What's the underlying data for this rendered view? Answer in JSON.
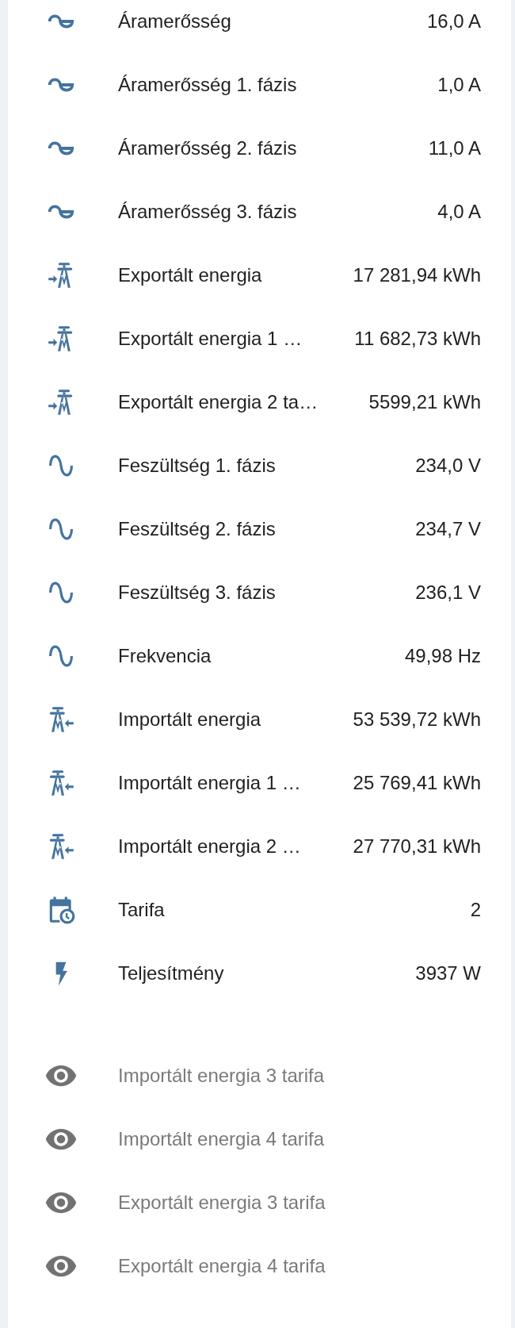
{
  "entities": [
    {
      "kind": "current",
      "name": "Áramerősség",
      "value": "16,0 A"
    },
    {
      "kind": "current",
      "name": "Áramerősség 1. fázis",
      "value": "1,0 A"
    },
    {
      "kind": "current",
      "name": "Áramerősség 2. fázis",
      "value": "11,0 A"
    },
    {
      "kind": "current",
      "name": "Áramerősség 3. fázis",
      "value": "4,0 A"
    },
    {
      "kind": "export",
      "name": "Exportált energia",
      "value": "17 281,94 kWh"
    },
    {
      "kind": "export",
      "name": "Exportált energia 1 …",
      "value": "11 682,73 kWh"
    },
    {
      "kind": "export",
      "name": "Exportált energia 2 ta…",
      "value": "5599,21 kWh"
    },
    {
      "kind": "voltage",
      "name": "Feszültség 1. fázis",
      "value": "234,0 V"
    },
    {
      "kind": "voltage",
      "name": "Feszültség 2. fázis",
      "value": "234,7 V"
    },
    {
      "kind": "voltage",
      "name": "Feszültség 3. fázis",
      "value": "236,1 V"
    },
    {
      "kind": "voltage",
      "name": "Frekvencia",
      "value": "49,98 Hz"
    },
    {
      "kind": "import",
      "name": "Importált energia",
      "value": "53 539,72 kWh"
    },
    {
      "kind": "import",
      "name": "Importált energia 1 …",
      "value": "25 769,41 kWh"
    },
    {
      "kind": "import",
      "name": "Importált energia 2 …",
      "value": "27 770,31 kWh"
    },
    {
      "kind": "tariff",
      "name": "Tarifa",
      "value": "2"
    },
    {
      "kind": "power",
      "name": "Teljesítmény",
      "value": "3937 W"
    }
  ],
  "hidden_entities": [
    {
      "name": "Importált energia 3 tarifa"
    },
    {
      "name": "Importált energia 4 tarifa"
    },
    {
      "name": "Exportált energia 3 tarifa"
    },
    {
      "name": "Exportált energia 4 tarifa"
    }
  ]
}
